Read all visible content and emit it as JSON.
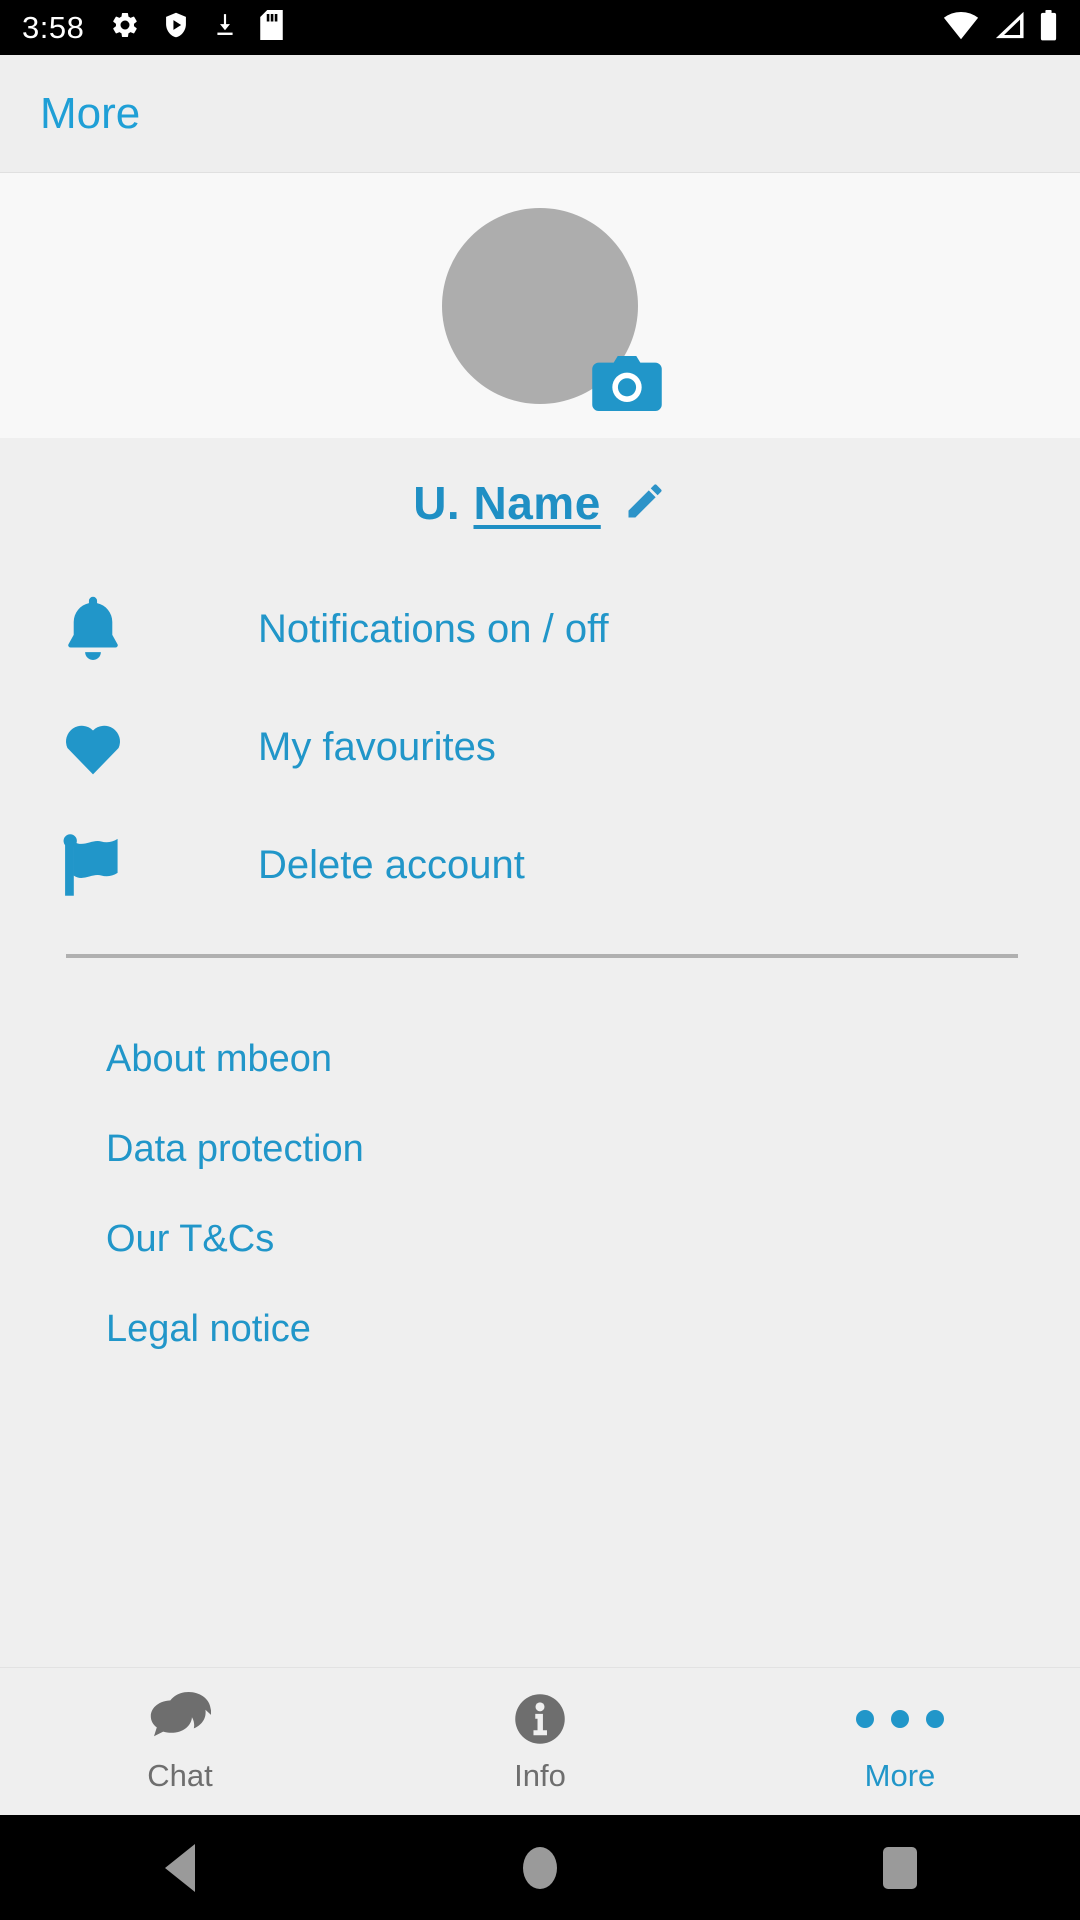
{
  "status_bar": {
    "time": "3:58",
    "left_icons": [
      "gear-icon",
      "play-protect-shield-icon",
      "download-icon",
      "sd-card-icon"
    ],
    "right_icons": [
      "wifi-icon",
      "cellular-signal-icon",
      "battery-icon"
    ]
  },
  "app_bar": {
    "title": "More"
  },
  "profile": {
    "avatar_alt": "profile-avatar-placeholder",
    "avatar_color": "#adadad",
    "camera_badge_icon": "camera-icon",
    "camera_badge_color": "#2196c9",
    "name_prefix": "U. ",
    "name_main": "Name",
    "edit_icon": "pencil-icon"
  },
  "menu": {
    "items": [
      {
        "label": "Notifications on / off",
        "icon": "bell-icon"
      },
      {
        "label": "My favourites",
        "icon": "heart-icon"
      },
      {
        "label": "Delete account",
        "icon": "flag-icon"
      }
    ]
  },
  "links": {
    "items": [
      {
        "label": "About mbeon"
      },
      {
        "label": "Data protection"
      },
      {
        "label": "Our T&Cs"
      },
      {
        "label": "Legal notice"
      }
    ]
  },
  "tab_bar": {
    "tabs": [
      {
        "label": "Chat",
        "icon": "chat-bubbles-icon",
        "active": false
      },
      {
        "label": "Info",
        "icon": "info-circle-icon",
        "active": false
      },
      {
        "label": "More",
        "icon": "three-dots-icon",
        "active": true
      }
    ]
  },
  "nav_bar": {
    "buttons": [
      "back-button",
      "home-button",
      "recents-button"
    ]
  },
  "colors": {
    "accent": "#2196c9",
    "title_accent": "#1f9fd6",
    "inactive_tab": "#6e6e6e",
    "divider": "#b0b0b0",
    "page_bg": "#efefef"
  }
}
